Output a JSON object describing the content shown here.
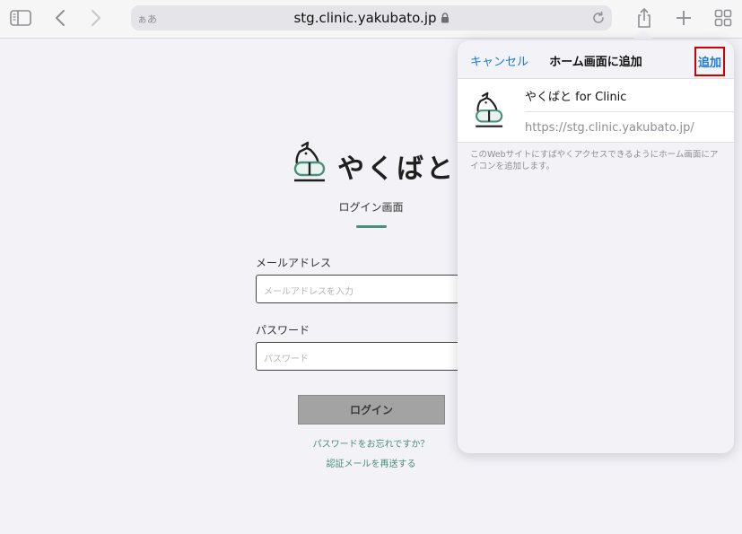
{
  "toolbar": {
    "address_hint": "ぁあ",
    "url": "stg.clinic.yakubato.jp",
    "icons": [
      "sidebar-icon",
      "back-icon",
      "forward-icon",
      "lock-icon",
      "reload-icon",
      "share-icon",
      "new-tab-icon",
      "tabs-overview-icon"
    ]
  },
  "login": {
    "logo_text": "やくばと",
    "title": "ログイン画面",
    "email_label": "メールアドレス",
    "email_placeholder": "メールアドレスを入力",
    "password_label": "パスワード",
    "password_placeholder": "パスワード",
    "login_button": "ログイン",
    "forgot_link": "パスワードをお忘れですか？",
    "resend_link": "認証メールを再送する"
  },
  "popover": {
    "cancel": "キャンセル",
    "title": "ホーム画面に追加",
    "add": "追加",
    "app_name": "やくばと for Clinic",
    "app_url": "https://stg.clinic.yakubato.jp/",
    "description": "このWebサイトにすばやくアクセスできるようにホーム画面にアイコンを追加します。"
  },
  "colors": {
    "accent_blue": "#1a7ae0",
    "brand_green": "#4a8f7c",
    "highlight_red": "#d10000"
  }
}
